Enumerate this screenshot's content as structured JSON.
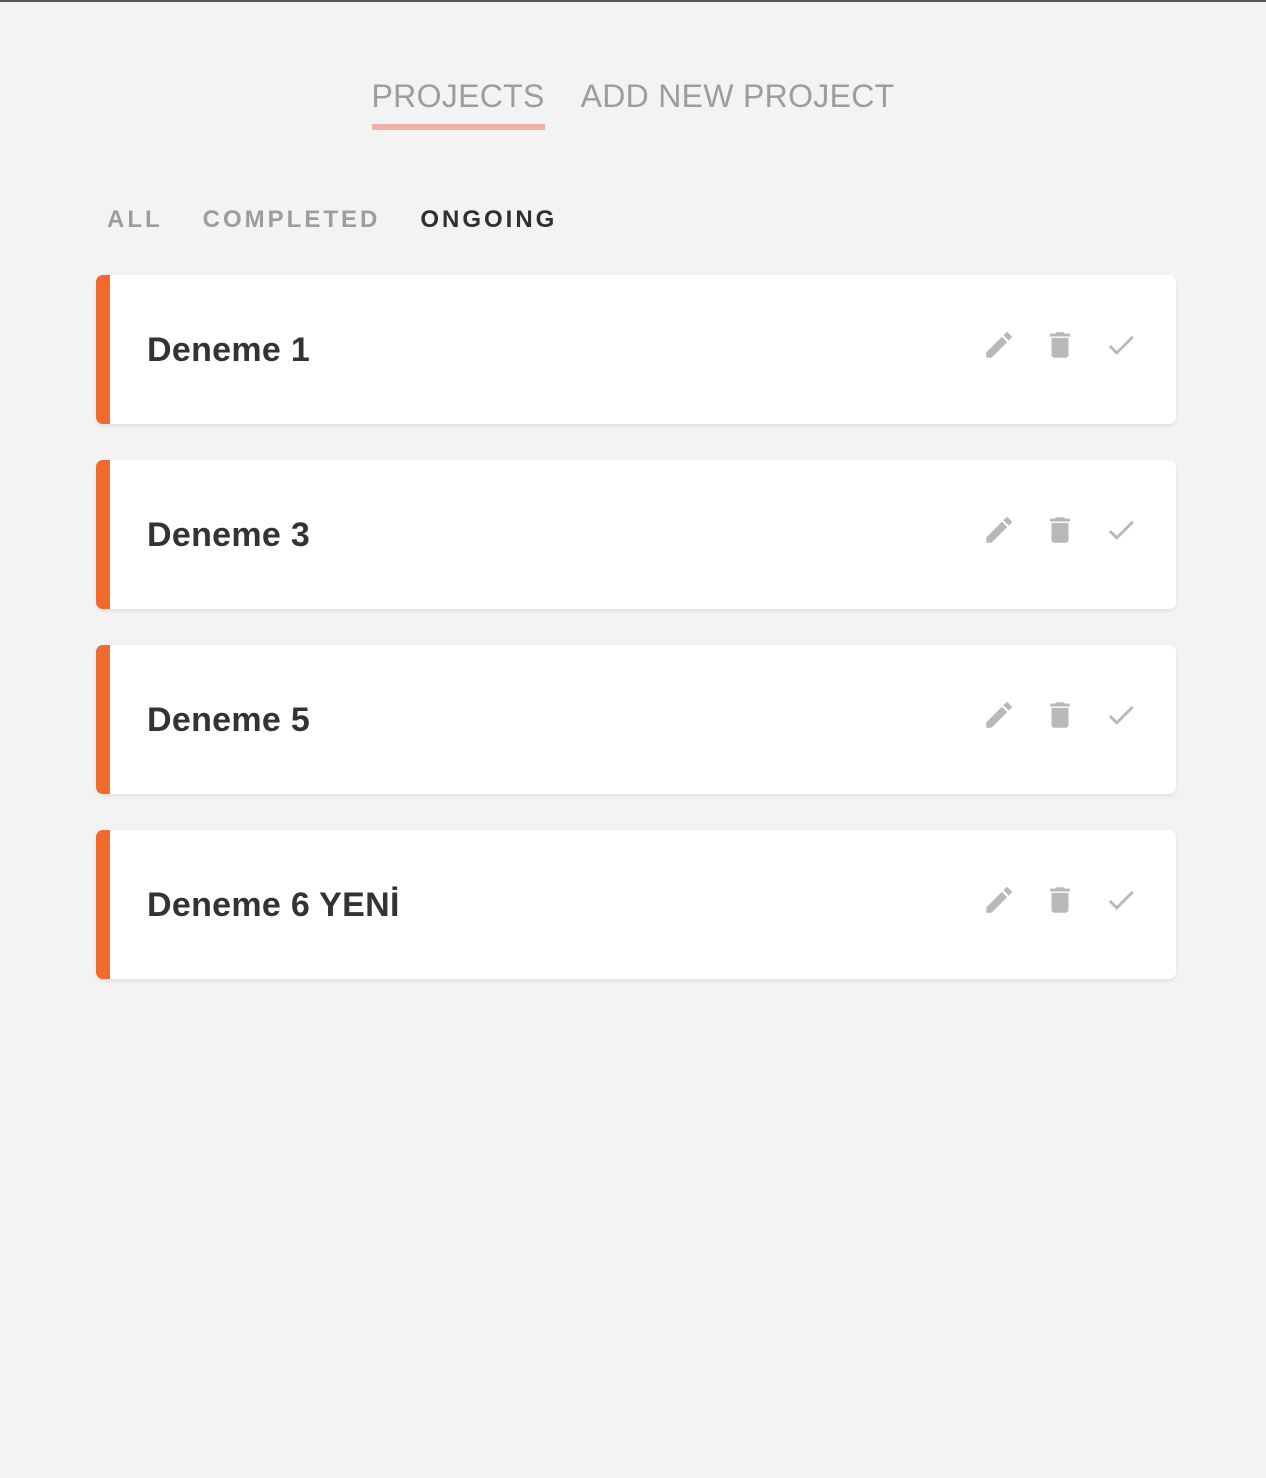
{
  "nav": {
    "tabs": [
      {
        "label": "PROJECTS",
        "active": true
      },
      {
        "label": "ADD NEW PROJECT",
        "active": false
      }
    ]
  },
  "filters": {
    "items": [
      {
        "label": "ALL",
        "active": false
      },
      {
        "label": "COMPLETED",
        "active": false
      },
      {
        "label": "ONGOING",
        "active": true
      }
    ]
  },
  "projects": [
    {
      "name": "Deneme 1"
    },
    {
      "name": "Deneme 3"
    },
    {
      "name": "Deneme 5"
    },
    {
      "name": "Deneme 6 YENİ"
    }
  ],
  "icons": {
    "edit": "pencil-icon",
    "delete": "trash-icon",
    "complete": "check-icon"
  },
  "colors": {
    "accent": "#ef6a2c",
    "active_tab_underline": "#f2b1a8",
    "icon": "#b8b8b8",
    "background": "#f3f3f3"
  }
}
